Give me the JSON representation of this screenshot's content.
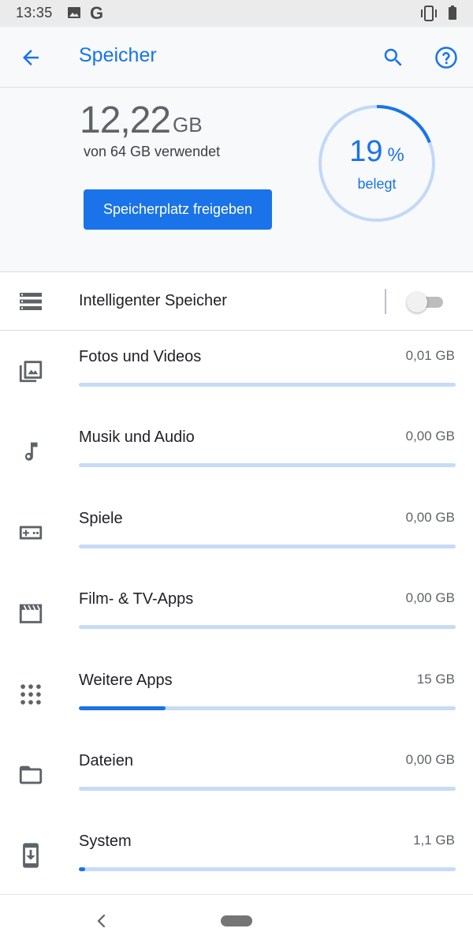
{
  "status_bar": {
    "time": "13:35",
    "icons": [
      "image-icon",
      "google-g-icon",
      "vibrate-icon",
      "battery-icon"
    ]
  },
  "app_bar": {
    "title": "Speicher",
    "icons": [
      "back-arrow-icon",
      "search-icon",
      "help-icon"
    ],
    "accent_color": "#1a73e8"
  },
  "summary": {
    "used_value": "12,22",
    "used_unit": "GB",
    "of_total": "von 64 GB verwendet",
    "free_button": "Speicherplatz freigeben",
    "percent_value": "19",
    "percent_symbol": "%",
    "percent_caption": "belegt",
    "percent_fraction": 0.19
  },
  "smart_storage": {
    "label": "Intelligenter Speicher",
    "icon": "storage-list-icon",
    "enabled": false
  },
  "categories": [
    {
      "label": "Fotos und Videos",
      "size": "0,01 GB",
      "icon": "photo-icon",
      "usage_fraction": 0.0
    },
    {
      "label": "Musik und Audio",
      "size": "0,00 GB",
      "icon": "music-note-icon",
      "usage_fraction": 0.0
    },
    {
      "label": "Spiele",
      "size": "0,00 GB",
      "icon": "gamepad-icon",
      "usage_fraction": 0.0
    },
    {
      "label": "Film- & TV-Apps",
      "size": "0,00 GB",
      "icon": "movie-icon",
      "usage_fraction": 0.0
    },
    {
      "label": "Weitere Apps",
      "size": "15 GB",
      "icon": "apps-grid-icon",
      "usage_fraction": 0.23
    },
    {
      "label": "Dateien",
      "size": "0,00 GB",
      "icon": "folder-icon",
      "usage_fraction": 0.0
    },
    {
      "label": "System",
      "size": "1,1 GB",
      "icon": "system-update-icon",
      "usage_fraction": 0.017
    }
  ],
  "nav_bar": {
    "icons": [
      "nav-back-icon",
      "home-pill-icon"
    ]
  }
}
